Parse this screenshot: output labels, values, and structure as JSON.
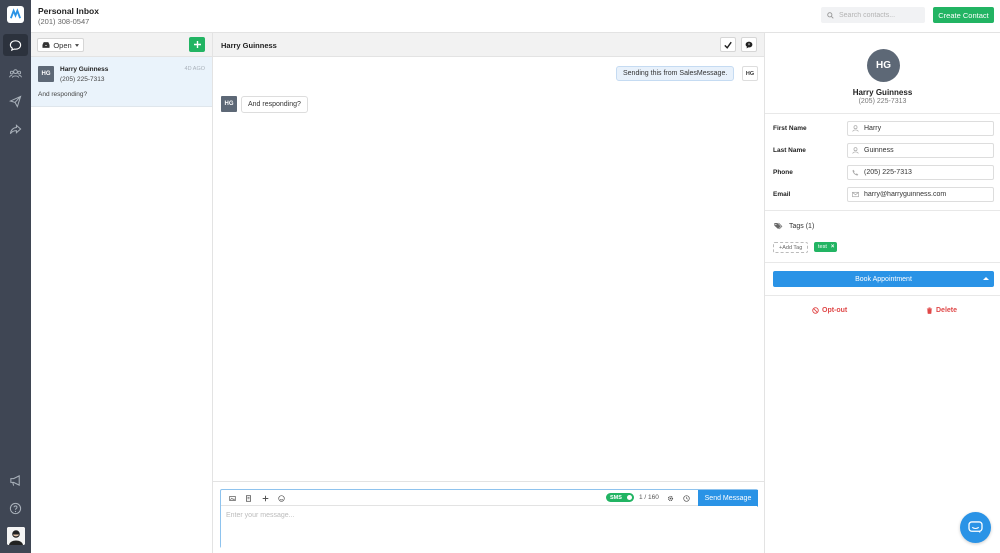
{
  "header": {
    "inbox_title": "Personal Inbox",
    "inbox_phone": "(201) 308-0547",
    "search_placeholder": "Search contacts...",
    "create_contact": "Create Contact"
  },
  "rail": {
    "icons": [
      "logo-icon",
      "conversations-icon",
      "contacts-icon",
      "broadcast-icon",
      "forward-icon",
      "megaphone-icon",
      "help-icon",
      "user-avatar"
    ]
  },
  "conversations": {
    "filter": "Open",
    "items": [
      {
        "initials": "HG",
        "name": "Harry Guinness",
        "phone": "(205) 225-7313",
        "time": "4D AGO",
        "preview": "And responding?"
      }
    ]
  },
  "chat": {
    "title": "Harry Guinness",
    "messages": [
      {
        "direction": "out",
        "text": "Sending this from SalesMessage.",
        "initials": "HG"
      },
      {
        "direction": "in",
        "text": "And responding?",
        "initials": "HG"
      }
    ],
    "composer": {
      "sms_label": "SMS",
      "char_count": "1 / 160",
      "send": "Send Message",
      "placeholder": "Enter your message..."
    }
  },
  "contact": {
    "initials": "HG",
    "name": "Harry Guinness",
    "phone": "(205) 225-7313",
    "fields": {
      "first_name_label": "First Name",
      "first_name": "Harry",
      "last_name_label": "Last Name",
      "last_name": "Guinness",
      "phone_label": "Phone",
      "phone": "(205) 225-7313",
      "email_label": "Email",
      "email": "harry@harryguinness.com"
    },
    "tags_label": "Tags (1)",
    "add_tag": "+Add Tag",
    "tags": [
      "test"
    ],
    "book_appointment": "Book Appointment",
    "opt_out": "Opt-out",
    "delete": "Delete"
  },
  "colors": {
    "rail": "#3f4654",
    "green": "#22b463",
    "blue": "#2a93e6",
    "danger": "#e04848",
    "selected_row": "#eaf3fb"
  }
}
